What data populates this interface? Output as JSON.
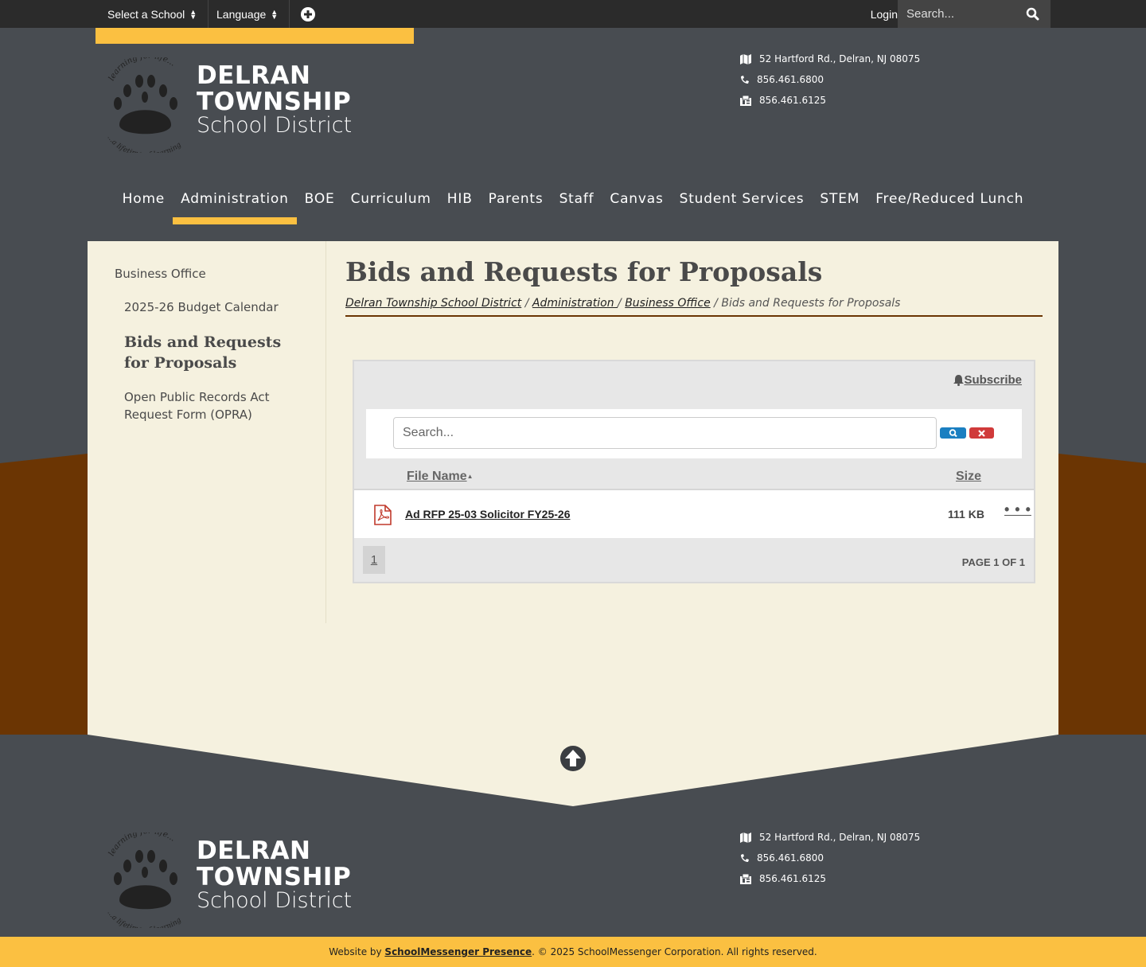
{
  "topbar": {
    "select_school": "Select a School",
    "language": "Language",
    "login": "Login",
    "search_placeholder": "Search..."
  },
  "site": {
    "name_line1": "DELRAN",
    "name_line2": "TOWNSHIP",
    "name_line3": "School District",
    "logo_motto_top": "learning for life...",
    "logo_motto_bottom": "...a lifetime of learning"
  },
  "contact": {
    "address": "52 Hartford Rd., Delran, NJ 08075",
    "phone": "856.461.6800",
    "fax": "856.461.6125"
  },
  "nav": [
    {
      "label": "Home"
    },
    {
      "label": "Administration",
      "active": true
    },
    {
      "label": "BOE"
    },
    {
      "label": "Curriculum"
    },
    {
      "label": "HIB"
    },
    {
      "label": "Parents"
    },
    {
      "label": "Staff"
    },
    {
      "label": "Canvas"
    },
    {
      "label": "Student Services"
    },
    {
      "label": "STEM"
    },
    {
      "label": "Free/Reduced Lunch"
    }
  ],
  "sidebar": {
    "parent": "Business Office",
    "items": [
      {
        "label": "2025-26 Budget Calendar"
      },
      {
        "label": "Bids and Requests for Proposals",
        "active": true
      },
      {
        "label": "Open Public Records Act Request Form (OPRA)"
      }
    ]
  },
  "page": {
    "title": "Bids and Requests for Proposals",
    "breadcrumb": [
      {
        "label": "Delran Township School District",
        "link": true
      },
      {
        "label": "Administration ",
        "link": true
      },
      {
        "label": "Business Office",
        "link": true
      },
      {
        "label": "Bids and Requests for Proposals",
        "link": false
      }
    ]
  },
  "files": {
    "subscribe": "Subscribe",
    "search_placeholder": "Search...",
    "col_name": "File Name",
    "col_size": "Size",
    "rows": [
      {
        "name": "Ad RFP 25-03 Solicitor FY25-26",
        "size": "111 KB",
        "more": "• • •"
      }
    ],
    "page_number": "1",
    "page_count": "PAGE 1 OF 1"
  },
  "footer": {
    "prefix": "Website by ",
    "link": "SchoolMessenger Presence",
    "suffix": ". © 2025 SchoolMessenger Corporation. All rights reserved."
  },
  "colors": {
    "gold": "#fbc041",
    "brown": "#6b3503",
    "slate": "#484c51",
    "cream": "#f5f1df"
  }
}
